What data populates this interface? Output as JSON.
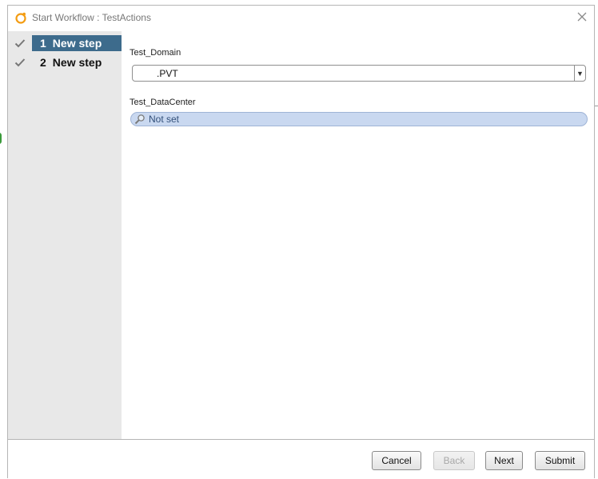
{
  "window": {
    "title": "Start Workflow : TestActions",
    "app_icon": "orchestrator-ring-icon",
    "close_icon": "close-icon"
  },
  "sidebar": {
    "steps": [
      {
        "number": "1",
        "label": "New step",
        "active": true,
        "status_icon": "checkmark-icon"
      },
      {
        "number": "2",
        "label": "New step",
        "active": false,
        "status_icon": "checkmark-icon"
      }
    ]
  },
  "form": {
    "domain": {
      "label": "Test_Domain",
      "value": ".PVT"
    },
    "datacenter": {
      "label": "Test_DataCenter",
      "value": "Not set"
    }
  },
  "footer": {
    "cancel_label": "Cancel",
    "back_label": "Back",
    "next_label": "Next",
    "submit_label": "Submit"
  },
  "colors": {
    "accent_icon": "#f39c12",
    "active_step_bg": "#3d6b8c",
    "lookup_bg": "#c9d8f0"
  }
}
